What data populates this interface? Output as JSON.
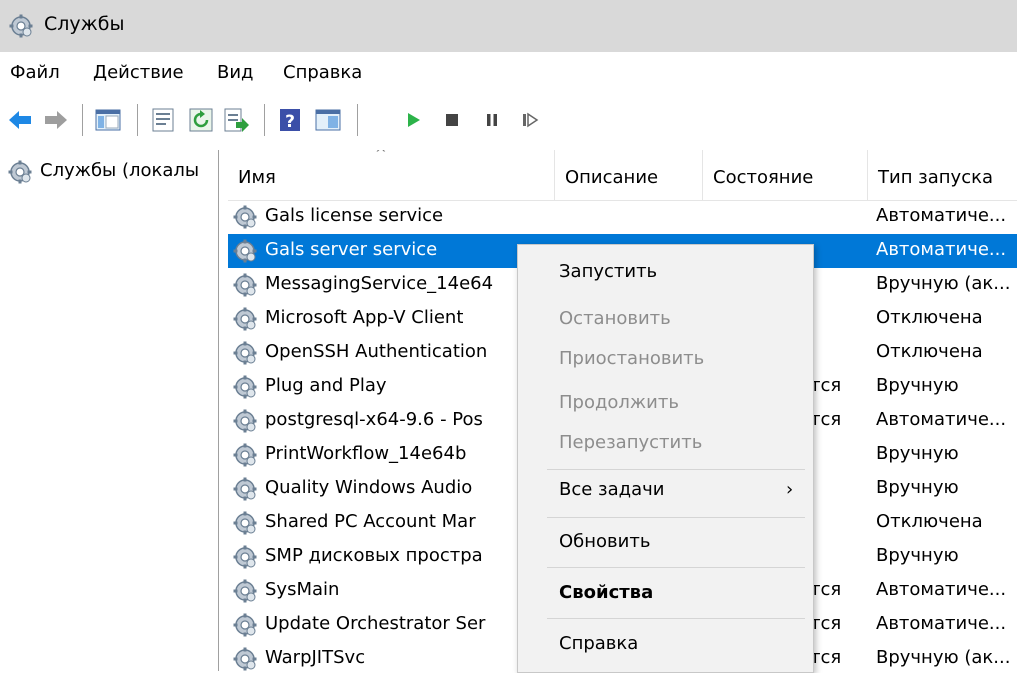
{
  "window": {
    "title": "Службы"
  },
  "menu": [
    "Файл",
    "Действие",
    "Вид",
    "Справка"
  ],
  "toolbar_icons": [
    "back-arrow-icon",
    "forward-arrow-icon",
    "console-tree-icon",
    "properties-icon",
    "refresh-icon",
    "export-list-icon",
    "help-icon",
    "console-icon",
    "start-icon",
    "stop-icon",
    "pause-icon",
    "resume-icon"
  ],
  "tree": {
    "root_label": "Службы (локалы"
  },
  "columns": {
    "name": "Имя",
    "description": "Описание",
    "status": "Состояние",
    "startup": "Тип запуска"
  },
  "rows": [
    {
      "name": "Gals license service",
      "state": "",
      "startup": "Автоматиче..."
    },
    {
      "name": "Gals server service",
      "state": "",
      "startup": "Автоматиче...",
      "selected": true
    },
    {
      "name": "MessagingService_14e64",
      "state": "",
      "startup": "Вручную (ак..."
    },
    {
      "name": "Microsoft App-V Client",
      "state": "",
      "startup": "Отключена"
    },
    {
      "name": "OpenSSH Authentication",
      "state": "",
      "startup": "Отключена"
    },
    {
      "name": "Plug and Play",
      "state": "тся",
      "startup": "Вручную"
    },
    {
      "name": "postgresql-x64-9.6 - Pos",
      "state": "тся",
      "startup": "Автоматиче..."
    },
    {
      "name": "PrintWorkflow_14e64b",
      "state": "",
      "startup": "Вручную"
    },
    {
      "name": "Quality Windows Audio",
      "state": "",
      "startup": "Вручную"
    },
    {
      "name": "Shared PC Account Mar",
      "state": "",
      "startup": "Отключена"
    },
    {
      "name": "SMP дисковых простра",
      "state": "",
      "startup": "Вручную"
    },
    {
      "name": "SysMain",
      "state": "тся",
      "startup": "Автоматиче..."
    },
    {
      "name": "Update Orchestrator Ser",
      "state": "тся",
      "startup": "Автоматиче..."
    },
    {
      "name": "WarpJITSvc",
      "state": "тся",
      "startup": "Вручную (ак..."
    }
  ],
  "context_menu": [
    {
      "label": "Запустить",
      "disabled": false
    },
    {
      "label": "Остановить",
      "disabled": true
    },
    {
      "label": "Приостановить",
      "disabled": true
    },
    {
      "label": "Продолжить",
      "disabled": true
    },
    {
      "label": "Перезапустить",
      "disabled": true
    },
    {
      "label": "Все задачи",
      "submenu": true,
      "arrow": "›"
    },
    {
      "label": "Обновить"
    },
    {
      "label": "Свойства",
      "bold": true
    },
    {
      "label": "Справка"
    }
  ],
  "colors": {
    "selection": "#0078d7",
    "titlebar": "#d9d9d9",
    "menu_bg": "#f2f2f2"
  }
}
